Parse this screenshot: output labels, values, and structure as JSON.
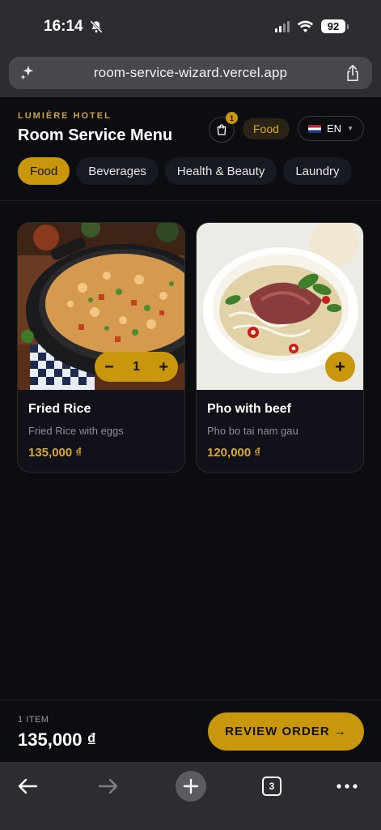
{
  "status_bar": {
    "time": "16:14",
    "battery": "92"
  },
  "browser": {
    "url": "room-service-wizard.vercel.app",
    "tab_count": "3"
  },
  "header": {
    "brand": "LUMIÈRE HOTEL",
    "title": "Room Service Menu",
    "cart_count": "1",
    "active_category_chip": "Food",
    "language": "EN"
  },
  "categories": [
    "Food",
    "Beverages",
    "Health & Beauty",
    "Laundry"
  ],
  "products": [
    {
      "name": "Fried Rice",
      "description": "Fried Rice with eggs",
      "price": "135,000 ₫",
      "quantity": "1"
    },
    {
      "name": "Pho with beef",
      "description": "Pho bo tai nam gau",
      "price": "120,000 ₫"
    }
  ],
  "summary": {
    "item_count": "1 ITEM",
    "total": "135,000 ₫",
    "review_label": "REVIEW ORDER →"
  },
  "colors": {
    "accent": "#c9970c",
    "background": "#0c0d11",
    "card": "#111219"
  }
}
